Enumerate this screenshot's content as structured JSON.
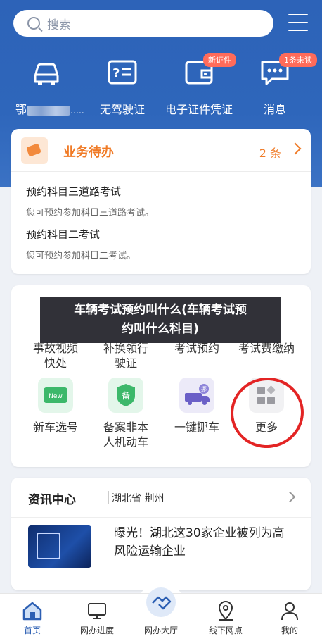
{
  "search": {
    "placeholder": "搜索"
  },
  "quick_actions": [
    {
      "label": "鄂",
      "label_suffix": "…..",
      "icon": "car-icon"
    },
    {
      "label": "无驾驶证",
      "icon": "license-card-icon"
    },
    {
      "label": "电子证件凭证",
      "icon": "wallet-icon",
      "badge": "新证件"
    },
    {
      "label": "消息",
      "icon": "message-icon",
      "badge": "1条未读"
    }
  ],
  "todo": {
    "title": "业务待办",
    "count": "2 条",
    "items": [
      {
        "title": "预约科目三道路考试",
        "desc": "您可预约参加科目三道路考试。"
      },
      {
        "title": "预约科目二考试",
        "desc": "您可预约参加科目二考试。"
      }
    ]
  },
  "overlay": {
    "line1": "车辆考试预约叫什么(车辆考试预",
    "line2": "约叫什么科目)"
  },
  "services_row1": [
    {
      "line1": "事故视频",
      "line2": "快处"
    },
    {
      "line1": "补换领行",
      "line2": "驶证"
    },
    {
      "line1": "考试预约",
      "line2": ""
    },
    {
      "line1": "考试费缴纳",
      "line2": ""
    }
  ],
  "services_row2": [
    {
      "line1": "新车选号",
      "line2": "",
      "icon": "new-plate-icon",
      "icon_text": "New"
    },
    {
      "line1": "备案非本",
      "line2": "人机动车",
      "icon": "record-shield-icon",
      "icon_text": "备"
    },
    {
      "line1": "一键挪车",
      "line2": "",
      "icon": "move-car-icon",
      "icon_text": "挪"
    },
    {
      "line1": "更多",
      "line2": "",
      "icon": "more-grid-icon"
    }
  ],
  "news": {
    "title": "资讯中心",
    "region": "湖北省 荆州",
    "headline": "曝光！湖北这30家企业被列为高风险运输企业"
  },
  "tabs": [
    {
      "label": "首页",
      "icon": "home-icon",
      "active": true
    },
    {
      "label": "网办进度",
      "icon": "monitor-icon"
    },
    {
      "label": "网办大厅",
      "icon": "handshake-icon"
    },
    {
      "label": "线下网点",
      "icon": "location-icon"
    },
    {
      "label": "我的",
      "icon": "user-icon"
    }
  ],
  "colors": {
    "header_blue": "#2e66bb",
    "accent_orange": "#f07b27",
    "active_tab": "#2c5fb3",
    "circle_red": "#e32424"
  }
}
